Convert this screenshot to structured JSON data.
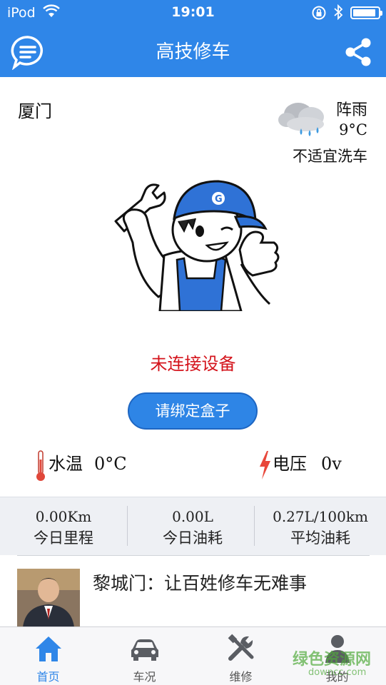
{
  "status_bar": {
    "carrier": "iPod",
    "time": "19:01",
    "battery_level": 0.9
  },
  "nav": {
    "title": "高技修车",
    "left_icon": "message-icon",
    "right_icon": "share-icon"
  },
  "location": {
    "city": "厦门"
  },
  "weather": {
    "icon": "rain-cloud-icon",
    "description": "阵雨",
    "temperature": "9°C",
    "car_wash": "不适宜洗车"
  },
  "device": {
    "status": "未连接设备",
    "bind_button": "请绑定盒子"
  },
  "gauges": {
    "water_temp": {
      "label": "水温",
      "value": "0°C",
      "icon": "thermometer-icon"
    },
    "voltage": {
      "label": "电压",
      "value": "0v",
      "icon": "lightning-icon"
    }
  },
  "stats": [
    {
      "value": "0.00Km",
      "label": "今日里程"
    },
    {
      "value": "0.00L",
      "label": "今日油耗"
    },
    {
      "value": "0.27L/100km",
      "label": "平均油耗"
    }
  ],
  "news": {
    "title": "黎城门：让百姓修车无难事"
  },
  "tabs": [
    {
      "label": "首页",
      "icon": "home-icon",
      "active": true
    },
    {
      "label": "车况",
      "icon": "car-icon",
      "active": false
    },
    {
      "label": "维修",
      "icon": "tools-icon",
      "active": false
    },
    {
      "label": "我的",
      "icon": "profile-icon",
      "active": false
    }
  ],
  "watermark": {
    "text": "绿色资源网",
    "url": "downcc.com"
  },
  "colors": {
    "primary": "#2f86e8",
    "alert": "#d4141c",
    "stats_bg": "#eef0f4"
  }
}
